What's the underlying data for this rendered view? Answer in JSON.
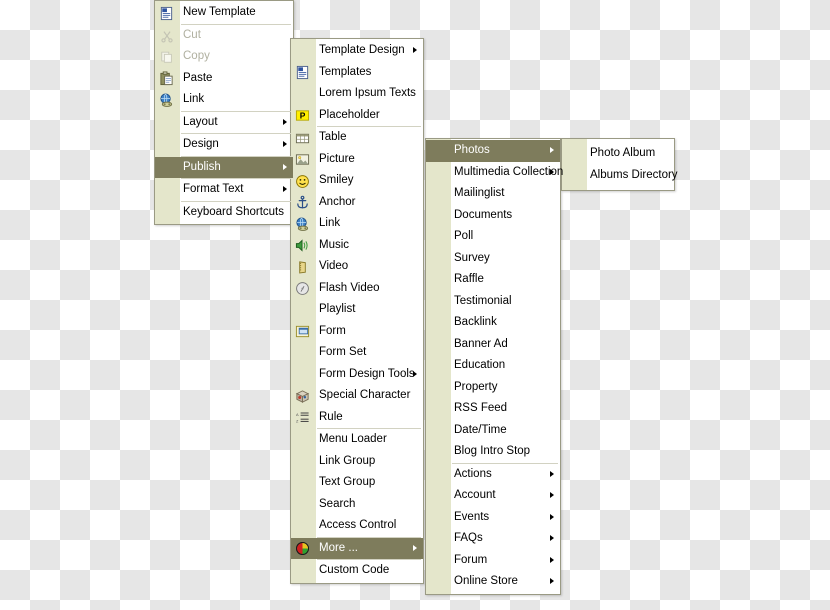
{
  "app": {
    "type": "cascading-context-menu",
    "colors": {
      "highlight": "#7e7c5c",
      "gutter": "#e4e6cb",
      "menu_background": "#ffffff",
      "border": "#9a9a84",
      "disabled_text": "#b0b0a0",
      "separator": "#d2d2c2"
    },
    "background": "transparency-checkerboard"
  },
  "menus": [
    {
      "id": "menu-root",
      "name": "root-context-menu",
      "items": [
        {
          "label": "New Template",
          "icon": "template-document-icon",
          "state": "normal",
          "submenu": false,
          "separator_after": true
        },
        {
          "label": "Cut",
          "icon": "scissors-icon",
          "state": "disabled",
          "submenu": false,
          "separator_after": false
        },
        {
          "label": "Copy",
          "icon": "copy-icon",
          "state": "disabled",
          "submenu": false,
          "separator_after": false
        },
        {
          "label": "Paste",
          "icon": "clipboard-icon",
          "state": "normal",
          "submenu": false,
          "separator_after": false
        },
        {
          "label": "Link",
          "icon": "globe-link-icon",
          "state": "normal",
          "submenu": false,
          "separator_after": true
        },
        {
          "label": "Layout",
          "icon": "none",
          "state": "normal",
          "submenu": true,
          "separator_after": true
        },
        {
          "label": "Design",
          "icon": "none",
          "state": "normal",
          "submenu": true,
          "separator_after": true
        },
        {
          "label": "Publish",
          "icon": "none",
          "state": "selected",
          "submenu": true,
          "separator_after": true
        },
        {
          "label": "Format Text",
          "icon": "none",
          "state": "normal",
          "submenu": true,
          "separator_after": true
        },
        {
          "label": "Keyboard Shortcuts",
          "icon": "none",
          "state": "normal",
          "submenu": false,
          "separator_after": false
        }
      ]
    },
    {
      "id": "menu-publish",
      "name": "publish-submenu",
      "items": [
        {
          "label": "Template Design",
          "icon": "none",
          "state": "normal",
          "submenu": true,
          "separator_after": false
        },
        {
          "label": "Templates",
          "icon": "template-document-icon",
          "state": "normal",
          "submenu": false,
          "separator_after": false
        },
        {
          "label": "Lorem Ipsum Texts",
          "icon": "none",
          "state": "normal",
          "submenu": false,
          "separator_after": false
        },
        {
          "label": "Placeholder",
          "icon": "placeholder-p-icon",
          "state": "normal",
          "submenu": false,
          "separator_after": true
        },
        {
          "label": "Table",
          "icon": "table-icon",
          "state": "normal",
          "submenu": false,
          "separator_after": false
        },
        {
          "label": "Picture",
          "icon": "picture-icon",
          "state": "normal",
          "submenu": false,
          "separator_after": false
        },
        {
          "label": "Smiley",
          "icon": "smiley-icon",
          "state": "normal",
          "submenu": false,
          "separator_after": false
        },
        {
          "label": "Anchor",
          "icon": "anchor-icon",
          "state": "normal",
          "submenu": false,
          "separator_after": false
        },
        {
          "label": "Link",
          "icon": "globe-link-icon",
          "state": "normal",
          "submenu": false,
          "separator_after": false
        },
        {
          "label": "Music",
          "icon": "speaker-music-icon",
          "state": "normal",
          "submenu": false,
          "separator_after": false
        },
        {
          "label": "Video",
          "icon": "film-video-icon",
          "state": "normal",
          "submenu": false,
          "separator_after": false
        },
        {
          "label": "Flash Video",
          "icon": "flash-video-icon",
          "state": "normal",
          "submenu": false,
          "separator_after": false
        },
        {
          "label": "Playlist",
          "icon": "none",
          "state": "normal",
          "submenu": false,
          "separator_after": false
        },
        {
          "label": "Form",
          "icon": "form-icon",
          "state": "normal",
          "submenu": false,
          "separator_after": false
        },
        {
          "label": "Form Set",
          "icon": "none",
          "state": "normal",
          "submenu": false,
          "separator_after": false
        },
        {
          "label": "Form Design Tools",
          "icon": "none",
          "state": "normal",
          "submenu": true,
          "separator_after": false
        },
        {
          "label": "Special Character",
          "icon": "special-character-icon",
          "state": "normal",
          "submenu": false,
          "separator_after": false
        },
        {
          "label": "Rule",
          "icon": "rule-list-icon",
          "state": "normal",
          "submenu": false,
          "separator_after": true
        },
        {
          "label": "Menu Loader",
          "icon": "none",
          "state": "normal",
          "submenu": false,
          "separator_after": false
        },
        {
          "label": "Link Group",
          "icon": "none",
          "state": "normal",
          "submenu": false,
          "separator_after": false
        },
        {
          "label": "Text Group",
          "icon": "none",
          "state": "normal",
          "submenu": false,
          "separator_after": false
        },
        {
          "label": "Search",
          "icon": "none",
          "state": "normal",
          "submenu": false,
          "separator_after": false
        },
        {
          "label": "Access Control",
          "icon": "none",
          "state": "normal",
          "submenu": false,
          "separator_after": true
        },
        {
          "label": "More ...",
          "icon": "pie-chart-icon",
          "state": "selected",
          "submenu": true,
          "separator_after": true
        },
        {
          "label": "Custom Code",
          "icon": "none",
          "state": "normal",
          "submenu": false,
          "separator_after": false
        }
      ]
    },
    {
      "id": "menu-more",
      "name": "more-submenu",
      "items": [
        {
          "label": "Photos",
          "icon": "none",
          "state": "selected",
          "submenu": true,
          "separator_after": false
        },
        {
          "label": "Multimedia Collection",
          "icon": "none",
          "state": "normal",
          "submenu": true,
          "separator_after": false
        },
        {
          "label": "Mailinglist",
          "icon": "none",
          "state": "normal",
          "submenu": false,
          "separator_after": false
        },
        {
          "label": "Documents",
          "icon": "none",
          "state": "normal",
          "submenu": false,
          "separator_after": false
        },
        {
          "label": "Poll",
          "icon": "none",
          "state": "normal",
          "submenu": false,
          "separator_after": false
        },
        {
          "label": "Survey",
          "icon": "none",
          "state": "normal",
          "submenu": false,
          "separator_after": false
        },
        {
          "label": "Raffle",
          "icon": "none",
          "state": "normal",
          "submenu": false,
          "separator_after": false
        },
        {
          "label": "Testimonial",
          "icon": "none",
          "state": "normal",
          "submenu": false,
          "separator_after": false
        },
        {
          "label": "Backlink",
          "icon": "none",
          "state": "normal",
          "submenu": false,
          "separator_after": false
        },
        {
          "label": "Banner Ad",
          "icon": "none",
          "state": "normal",
          "submenu": false,
          "separator_after": false
        },
        {
          "label": "Education",
          "icon": "none",
          "state": "normal",
          "submenu": false,
          "separator_after": false
        },
        {
          "label": "Property",
          "icon": "none",
          "state": "normal",
          "submenu": false,
          "separator_after": false
        },
        {
          "label": "RSS Feed",
          "icon": "none",
          "state": "normal",
          "submenu": false,
          "separator_after": false
        },
        {
          "label": "Date/Time",
          "icon": "none",
          "state": "normal",
          "submenu": false,
          "separator_after": false
        },
        {
          "label": "Blog Intro Stop",
          "icon": "none",
          "state": "normal",
          "submenu": false,
          "separator_after": true
        },
        {
          "label": "Actions",
          "icon": "none",
          "state": "normal",
          "submenu": true,
          "separator_after": false
        },
        {
          "label": "Account",
          "icon": "none",
          "state": "normal",
          "submenu": true,
          "separator_after": false
        },
        {
          "label": "Events",
          "icon": "none",
          "state": "normal",
          "submenu": true,
          "separator_after": false
        },
        {
          "label": "FAQs",
          "icon": "none",
          "state": "normal",
          "submenu": true,
          "separator_after": false
        },
        {
          "label": "Forum",
          "icon": "none",
          "state": "normal",
          "submenu": true,
          "separator_after": false
        },
        {
          "label": "Online Store",
          "icon": "none",
          "state": "normal",
          "submenu": true,
          "separator_after": false
        }
      ]
    },
    {
      "id": "menu-photos",
      "name": "photos-submenu",
      "items": [
        {
          "label": "Photo Album",
          "icon": "none",
          "state": "normal",
          "submenu": false,
          "separator_after": false
        },
        {
          "label": "Albums Directory",
          "icon": "none",
          "state": "normal",
          "submenu": false,
          "separator_after": false
        }
      ]
    }
  ]
}
